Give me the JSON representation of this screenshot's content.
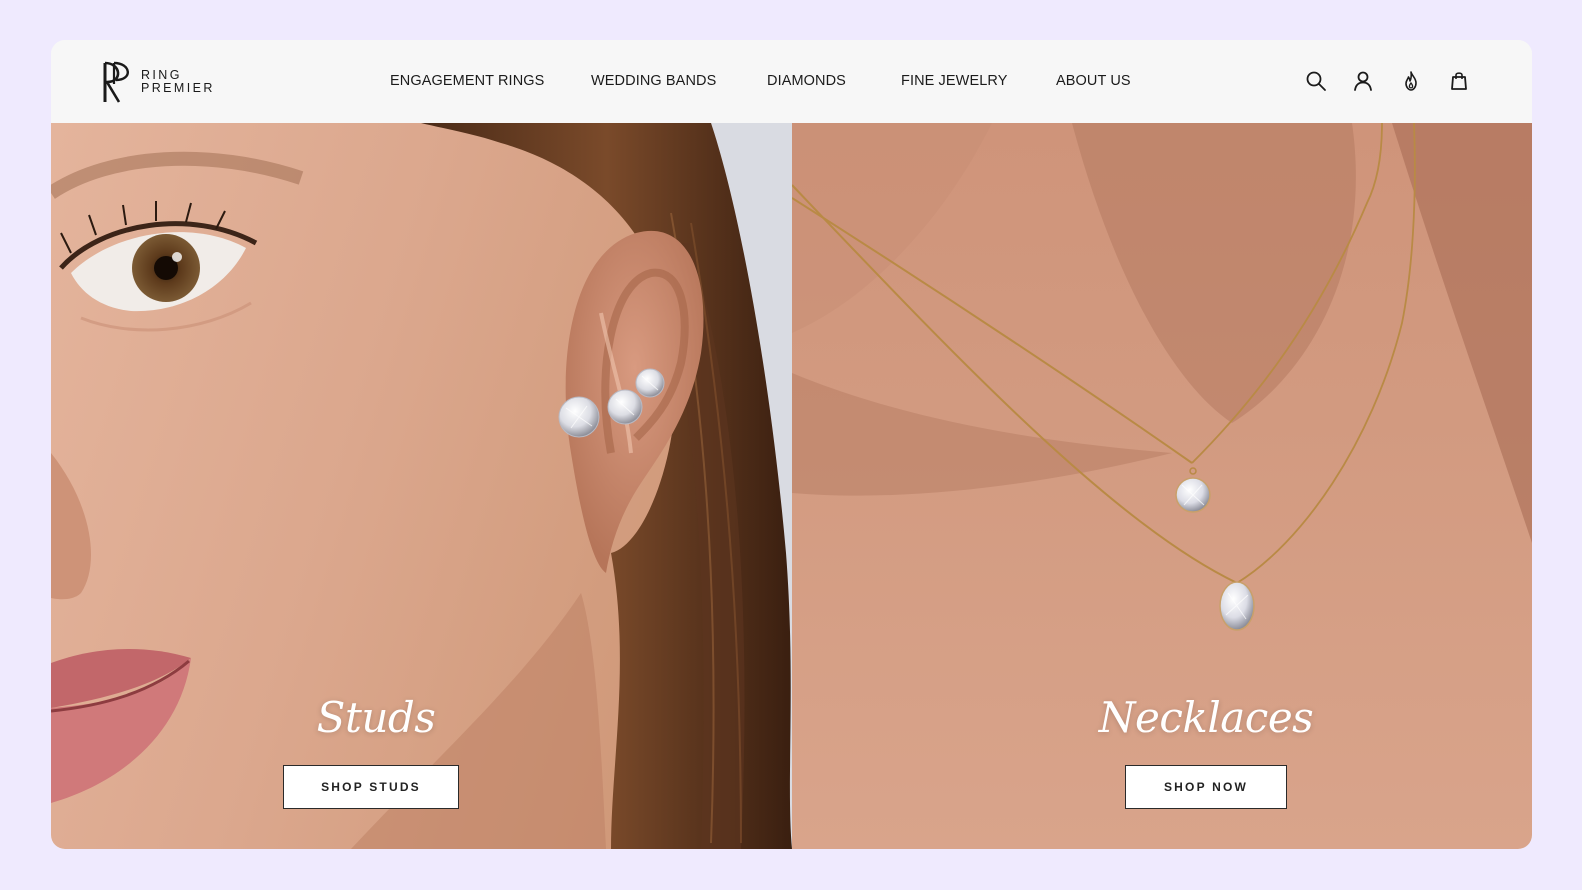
{
  "brand": {
    "line1": "RING",
    "line2": "PREMIER"
  },
  "nav": {
    "items": [
      {
        "label": "ENGAGEMENT RINGS"
      },
      {
        "label": "WEDDING BANDS"
      },
      {
        "label": "DIAMONDS"
      },
      {
        "label": "FINE JEWELRY"
      },
      {
        "label": "ABOUT US"
      }
    ],
    "icons": [
      "search-icon",
      "account-icon",
      "wishlist-flame-icon",
      "shopping-bag-icon"
    ]
  },
  "hero": {
    "left": {
      "title": "Studs",
      "cta": "SHOP STUDS"
    },
    "right": {
      "title": "Necklaces",
      "cta": "SHOP NOW"
    }
  },
  "colors": {
    "page_background": "#efeafe",
    "header_background": "#f7f7f7",
    "text": "#1b1b1b",
    "button_background": "#ffffff",
    "button_border": "#2a2a2a"
  }
}
